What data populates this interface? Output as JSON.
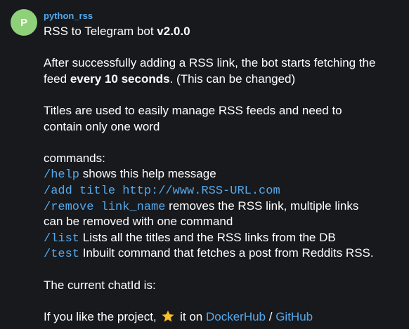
{
  "sender": {
    "name": "python_rss",
    "avatar_letter": "P",
    "avatar_color": "#8ed179"
  },
  "message": {
    "title_text": "RSS to Telegram bot ",
    "title_version": "v2.0.0",
    "intro_1": "After successfully adding a RSS link, the bot starts fetching the",
    "intro_2_pre": "feed ",
    "intro_2_bold": "every 10 seconds",
    "intro_2_post": ". (This can be changed)",
    "titles_1": "Titles are used to easily manage RSS feeds and need to",
    "titles_2": "contain only one word",
    "commands_label": "commands:",
    "commands": {
      "help_cmd": "/help",
      "help_desc": " shows this help message",
      "add_cmd": "/add title http://www.RSS-URL.com",
      "remove_cmd": "/remove link_name",
      "remove_desc": " removes the RSS link, multiple links",
      "remove_desc_2": "can be removed with one command",
      "list_cmd": "/list",
      "list_desc": " Lists all the titles and the RSS links from the DB",
      "test_cmd": "/test",
      "test_desc": " Inbuilt command that fetches a post from Reddits RSS."
    },
    "chatid_text": "The current chatId is:",
    "footer_pre": "If you like the project, ",
    "footer_mid": " it on ",
    "footer_link_dockerhub": "DockerHub",
    "footer_sep": " / ",
    "footer_link_github": "GitHub"
  },
  "colors": {
    "background": "#18191d",
    "accent": "#54a9eb",
    "text": "#ffffff"
  },
  "icons": {
    "star": "star-icon"
  }
}
